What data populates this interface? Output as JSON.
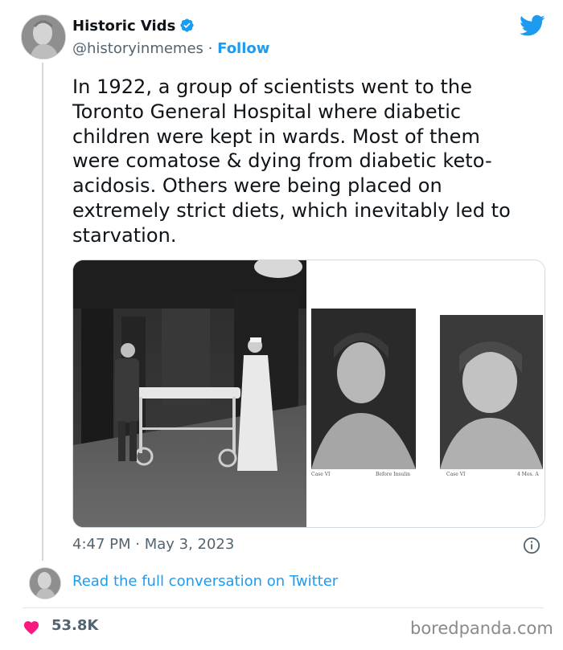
{
  "author": {
    "name": "Historic Vids",
    "handle": "@historyinmemes",
    "separator": "·",
    "follow_label": "Follow"
  },
  "tweet": {
    "text": "In 1922, a group of scientists went to the\nToronto General Hospital where diabetic\nchildren were kept in wards. Most of them\nwere comatose & dying from diabetic keto-\nacidosis. Others were being placed on\nextremely strict diets, which inevitably led to\nstarvation.",
    "timestamp": "4:47 PM · May 3, 2023"
  },
  "media": {
    "photo_right_captions": {
      "left_fragment": "Case VI",
      "before": "Before Insulin",
      "case": "Case VI",
      "duration": "4 Mos. A"
    }
  },
  "conversation": {
    "link_label": "Read the full conversation on Twitter"
  },
  "footer": {
    "likes": "53.8K",
    "watermark": "boredpanda.com"
  },
  "colors": {
    "accent": "#1d9bf0",
    "heart": "#f91880",
    "muted": "#536471"
  },
  "icons": [
    "verified-badge-icon",
    "twitter-bird-icon",
    "info-icon",
    "heart-icon"
  ]
}
